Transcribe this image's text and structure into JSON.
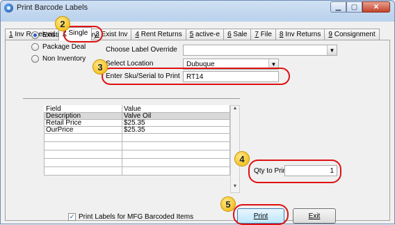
{
  "window": {
    "title": "Print Barcode Labels"
  },
  "tabs": [
    {
      "hotkey": "1",
      "label": " Inv Received"
    },
    {
      "hotkey": "2",
      "label": " Single"
    },
    {
      "hotkey": "3",
      "label": " Exist Inv"
    },
    {
      "hotkey": "4",
      "label": " Rent Returns"
    },
    {
      "hotkey": "5",
      "label": " active-e"
    },
    {
      "hotkey": "6",
      "label": " Sale"
    },
    {
      "hotkey": "7",
      "label": " File"
    },
    {
      "hotkey": "8",
      "label": " Inv Returns"
    },
    {
      "hotkey": "9",
      "label": " Consignment"
    }
  ],
  "inventory_type": {
    "options": [
      "Existing Inventory",
      "Package Deal",
      "Non Inventory"
    ],
    "selected": "Existing Inventory"
  },
  "form": {
    "label_override_label": "Choose Label Override",
    "label_override_value": "",
    "location_label": "Select Location",
    "location_value": "Dubuque",
    "sku_label": "Enter Sku/Serial to Print",
    "sku_value": "RT14",
    "qty_label": "Qty to Print",
    "qty_value": "1"
  },
  "grid": {
    "columns": [
      "Field",
      "Value"
    ],
    "rows": [
      [
        "Description",
        "Valve Oil"
      ],
      [
        "Retail Price",
        "$25.35"
      ],
      [
        "OurPrice",
        "$25.35"
      ],
      [
        "",
        ""
      ],
      [
        "",
        ""
      ],
      [
        "",
        ""
      ],
      [
        "",
        ""
      ],
      [
        "",
        ""
      ]
    ]
  },
  "footer": {
    "mfg_checkbox_label": "Print Labels for MFG Barcoded Items",
    "mfg_checked": true,
    "print_label": "Print",
    "exit_label": "Exit"
  },
  "callouts": [
    "2",
    "3",
    "4",
    "5"
  ]
}
